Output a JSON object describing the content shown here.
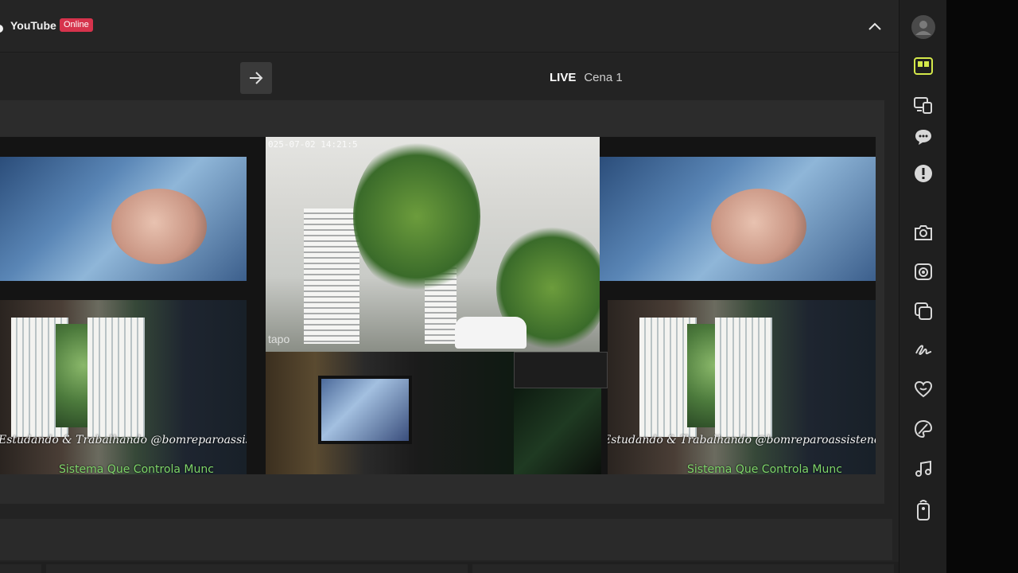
{
  "header": {
    "platform": "YouTube",
    "status": "Online"
  },
  "scene": {
    "live_label": "LIVE",
    "scene_name": "Cena 1"
  },
  "overlays": {
    "left_caption": "Estudando & Trabalhando @bomreparoassistenc",
    "left_subcaption": "Sistema Que Controla Munc",
    "right_caption": "Estudando & Trabalhando @bomreparoassistenc",
    "right_subcaption": "Sistema Que Controla Munc",
    "camera_timestamp": "025-07-02 14:21:5",
    "camera_brand": "tapo"
  },
  "sidebar": {
    "icons": [
      "avatar-icon",
      "layout-icon",
      "devices-icon",
      "chat-icon",
      "alert-icon",
      "camera-icon",
      "record-icon",
      "copy-icon",
      "signature-icon",
      "heart-icon",
      "palette-icon",
      "music-icon",
      "remote-icon"
    ]
  },
  "colors": {
    "accent": "#d4e84a",
    "badge": "#d6334c",
    "caption_green": "#7fd66a"
  }
}
